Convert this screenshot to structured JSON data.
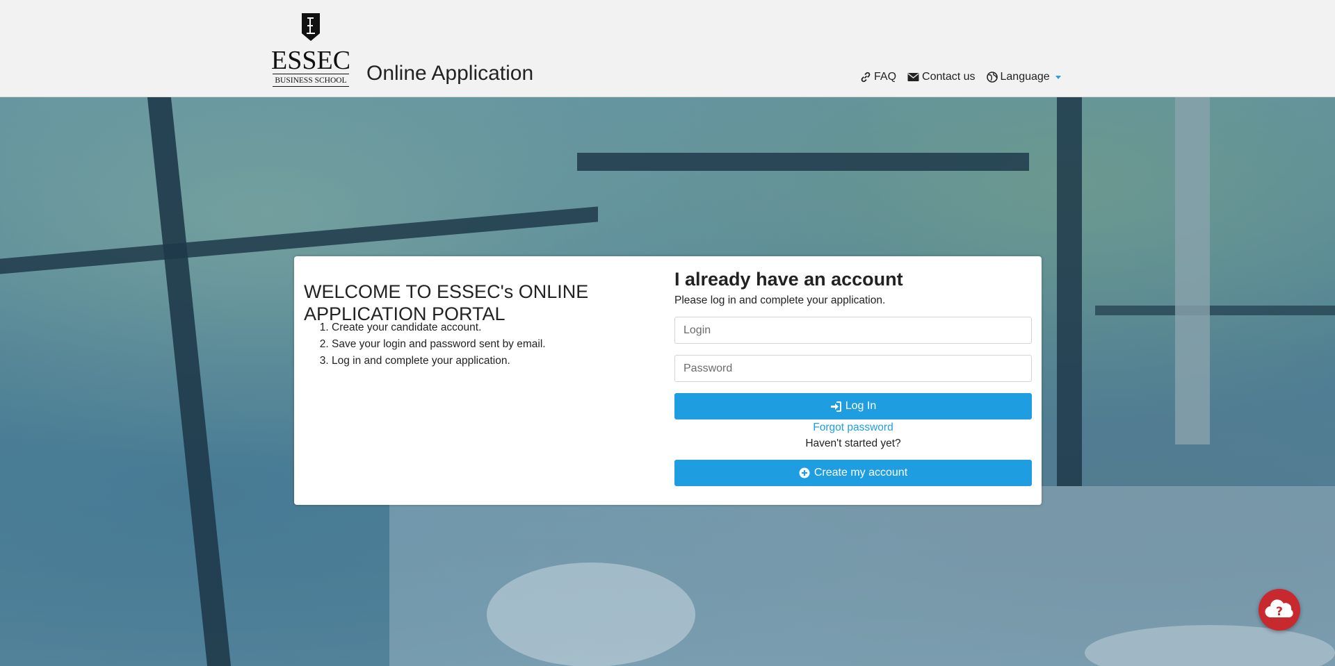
{
  "header": {
    "logo_text": "ESSEC",
    "logo_subtext": "BUSINESS SCHOOL",
    "site_title": "Online Application",
    "nav": {
      "faq": "FAQ",
      "contact": "Contact us",
      "language": "Language"
    }
  },
  "welcome": {
    "title": "WELCOME TO ESSEC's ONLINE APPLICATION PORTAL",
    "steps": [
      "Create your candidate account.",
      "Save your login and password sent by email.",
      "Log in and complete your application."
    ]
  },
  "login": {
    "title": "I already have an account",
    "subtitle": "Please log in and complete your application.",
    "login_placeholder": "Login",
    "password_placeholder": "Password",
    "login_button": "Log In",
    "forgot_password": "Forgot password",
    "not_started": "Haven't started yet?",
    "create_button": "Create my account"
  },
  "colors": {
    "primary": "#1e9ee0",
    "help_bubble": "#c8292f",
    "header_bg": "#f2f2f2"
  },
  "icons": {
    "faq": "link-icon",
    "contact": "envelope-icon",
    "language": "globe-icon",
    "login": "sign-in-icon",
    "create": "plus-circle-icon",
    "help": "question-cloud-icon"
  }
}
